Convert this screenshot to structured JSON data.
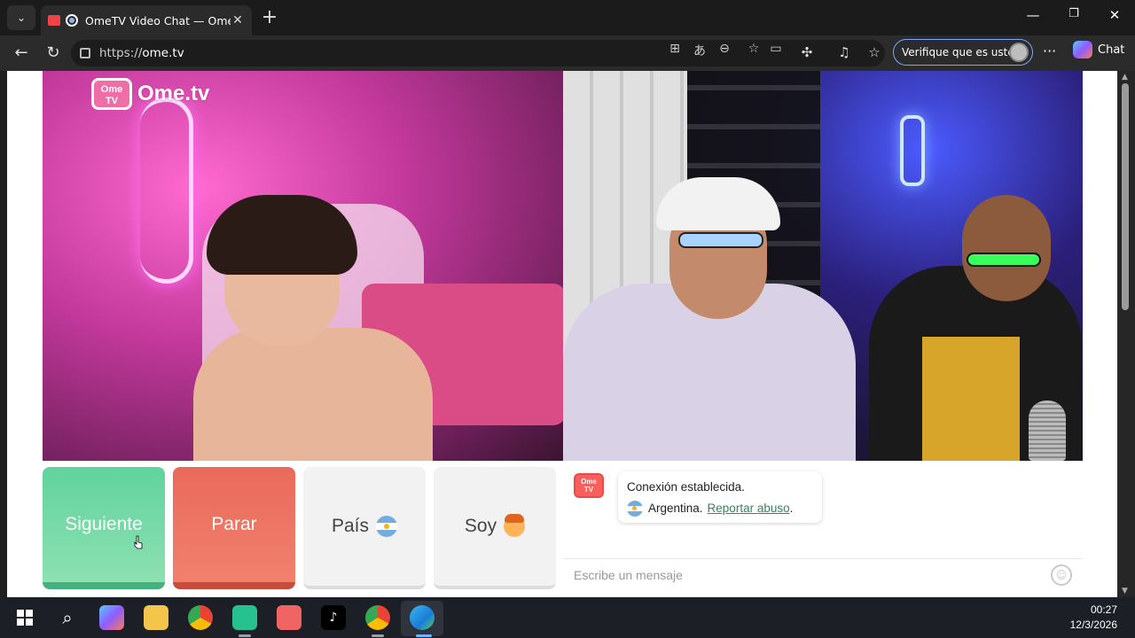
{
  "browser": {
    "tab_title": "OmeTV Video Chat — Omegl",
    "tab_close": "✕",
    "new_tab": "+",
    "url_scheme": "https://",
    "url_host": "ome.tv",
    "profile_label": "Verifique que es usted",
    "copilot_label": "Chat",
    "more_label": "···"
  },
  "site": {
    "logo_badge": "Ome TV",
    "logo_word": "Ome.tv"
  },
  "controls": {
    "next_label": "Siguiente",
    "stop_label": "Parar",
    "country_label": "País",
    "gender_label": "Soy"
  },
  "chat": {
    "logo_badge": "Ome TV",
    "status_line": "Conexión establecida.",
    "country": "Argentina.",
    "report_link": "Reportar abuso",
    "report_suffix": ".",
    "input_placeholder": "Escribe un mensaje"
  },
  "taskbar": {
    "time": "00:27",
    "date": "12/3/2026"
  },
  "colors": {
    "next": "#61d39d",
    "stop": "#ea6a5a",
    "report_link": "#2e8a5a",
    "profile_border": "#7aa7ff"
  },
  "icons": [
    "tab-menu-icon",
    "back-icon",
    "refresh-icon",
    "lock-icon",
    "apps-icon",
    "translate-icon",
    "reader-icon",
    "favorite-icon",
    "video-icon",
    "extensions-icon",
    "media-icon",
    "favorites-icon",
    "copilot-icon",
    "smiley-icon",
    "windows-start-icon",
    "search-icon",
    "copilot-taskbar-icon",
    "file-explorer-icon",
    "chrome-icon",
    "capcut-icon",
    "ometv-app-icon",
    "tiktok-icon",
    "chrome-profile-icon",
    "edge-icon"
  ]
}
